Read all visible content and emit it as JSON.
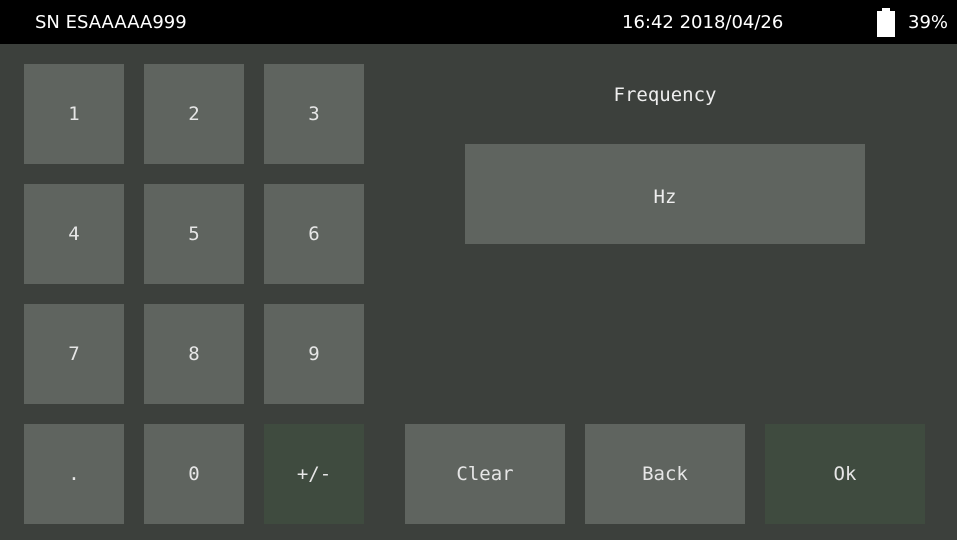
{
  "status_bar": {
    "serial": "SN ESAAAAA999",
    "datetime": "16:42 2018/04/26",
    "battery_icon": "battery-icon",
    "battery_percent": "39%",
    "battery_level": 0.39
  },
  "keypad": {
    "keys": [
      "1",
      "2",
      "3",
      "4",
      "5",
      "6",
      "7",
      "8",
      "9",
      ".",
      "0",
      "+/-"
    ]
  },
  "input": {
    "title": "Frequency",
    "value": "",
    "unit": "Hz"
  },
  "actions": {
    "clear": "Clear",
    "back": "Back",
    "ok": "Ok"
  },
  "colors": {
    "background": "#3c403c",
    "button": "#5f645f",
    "button_dark": "#3f4b3f",
    "status_bar": "#000000",
    "text": "#e6e6e6"
  }
}
